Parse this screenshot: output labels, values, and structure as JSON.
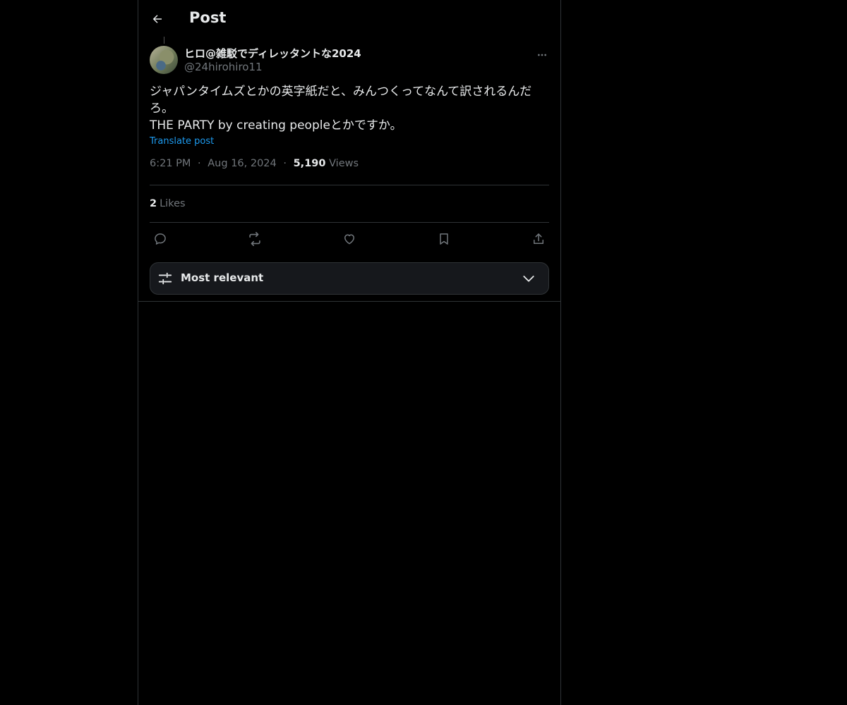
{
  "header": {
    "title": "Post",
    "back_icon": "arrow-left-icon"
  },
  "author": {
    "display_name": "ヒロ@雑駁でディレッタントな2024",
    "handle": "@24hirohiro11"
  },
  "post": {
    "lines": [
      "ジャパンタイムズとかの英字紙だと、みんつくってなんて訳されるんだろ。",
      "THE PARTY by creating peopleとかですか。"
    ],
    "translate_label": "Translate post",
    "time": "6:21 PM",
    "date": "Aug 16, 2024",
    "separator": "·",
    "views_count": "5,190",
    "views_label": "Views"
  },
  "stats": {
    "likes_count": "2",
    "likes_label": "Likes"
  },
  "actions": [
    "reply-icon",
    "repost-icon",
    "like-icon",
    "bookmark-icon",
    "share-icon"
  ],
  "sort": {
    "label": "Most relevant",
    "icon": "sliders-icon",
    "chevron": "chevron-down-icon"
  },
  "colors": {
    "background": "#000000",
    "text": "#e7e9ea",
    "muted": "#71767b",
    "accent": "#1d9bf0",
    "border": "#2f3336"
  }
}
